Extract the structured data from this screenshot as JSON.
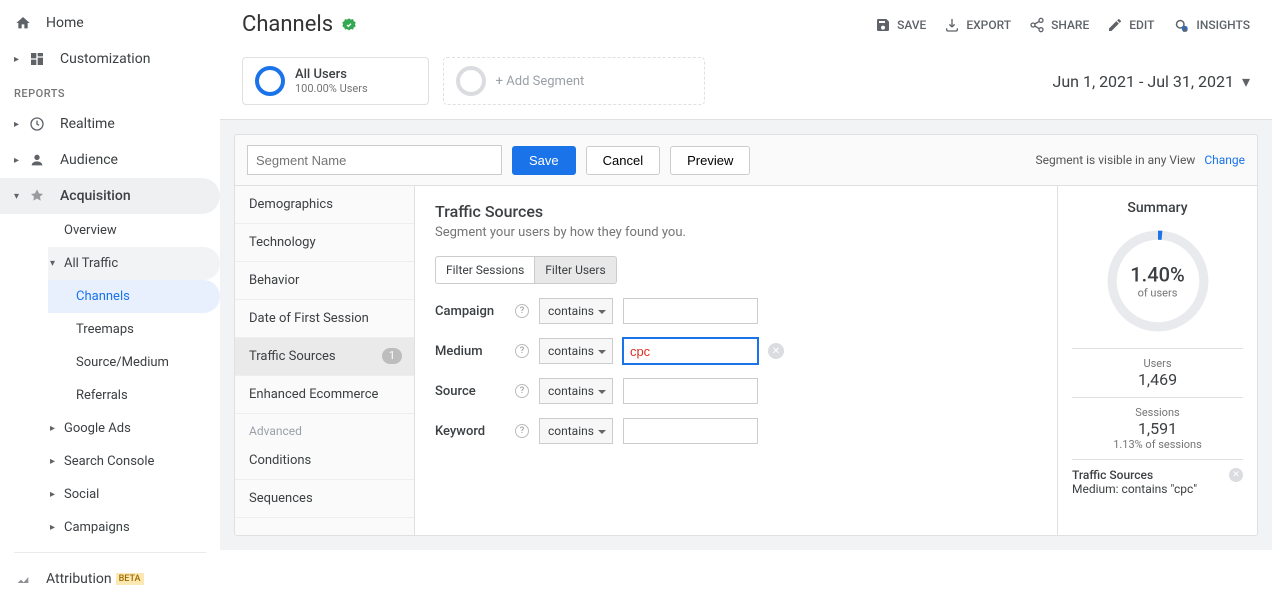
{
  "sidebar": {
    "home": "Home",
    "customization": "Customization",
    "reports_label": "REPORTS",
    "realtime": "Realtime",
    "audience": "Audience",
    "acquisition": "Acquisition",
    "overview": "Overview",
    "all_traffic": "All Traffic",
    "channels": "Channels",
    "treemaps": "Treemaps",
    "source_medium": "Source/Medium",
    "referrals": "Referrals",
    "google_ads": "Google Ads",
    "search_console": "Search Console",
    "social": "Social",
    "campaigns": "Campaigns",
    "attribution": "Attribution",
    "beta": "BETA"
  },
  "header": {
    "title": "Channels",
    "toolbar": {
      "save": "SAVE",
      "export": "EXPORT",
      "share": "SHARE",
      "edit": "EDIT",
      "insights": "INSIGHTS"
    }
  },
  "segbar": {
    "all_users": "All Users",
    "all_users_sub": "100.00% Users",
    "add_segment": "+ Add Segment",
    "daterange": "Jun 1, 2021 - Jul 31, 2021"
  },
  "editor": {
    "segment_name_placeholder": "Segment Name",
    "save": "Save",
    "cancel": "Cancel",
    "preview": "Preview",
    "visibility": "Segment is visible in any View",
    "change": "Change",
    "categories": {
      "demographics": "Demographics",
      "technology": "Technology",
      "behavior": "Behavior",
      "date_first": "Date of First Session",
      "traffic_sources": "Traffic Sources",
      "traffic_sources_badge": "1",
      "enhanced_ecom": "Enhanced Ecommerce",
      "advanced": "Advanced",
      "conditions": "Conditions",
      "sequences": "Sequences"
    },
    "form": {
      "title": "Traffic Sources",
      "desc": "Segment your users by how they found you.",
      "filter_sessions": "Filter Sessions",
      "filter_users": "Filter Users",
      "campaign": "Campaign",
      "medium": "Medium",
      "source": "Source",
      "keyword": "Keyword",
      "contains": "contains",
      "medium_value": "cpc"
    }
  },
  "summary": {
    "title": "Summary",
    "pct": "1.40%",
    "pct_sub": "of users",
    "users_label": "Users",
    "users_value": "1,469",
    "sessions_label": "Sessions",
    "sessions_value": "1,591",
    "sessions_sub": "1.13% of sessions",
    "applied_title": "Traffic Sources",
    "applied_desc": "Medium: contains \"cpc\""
  }
}
